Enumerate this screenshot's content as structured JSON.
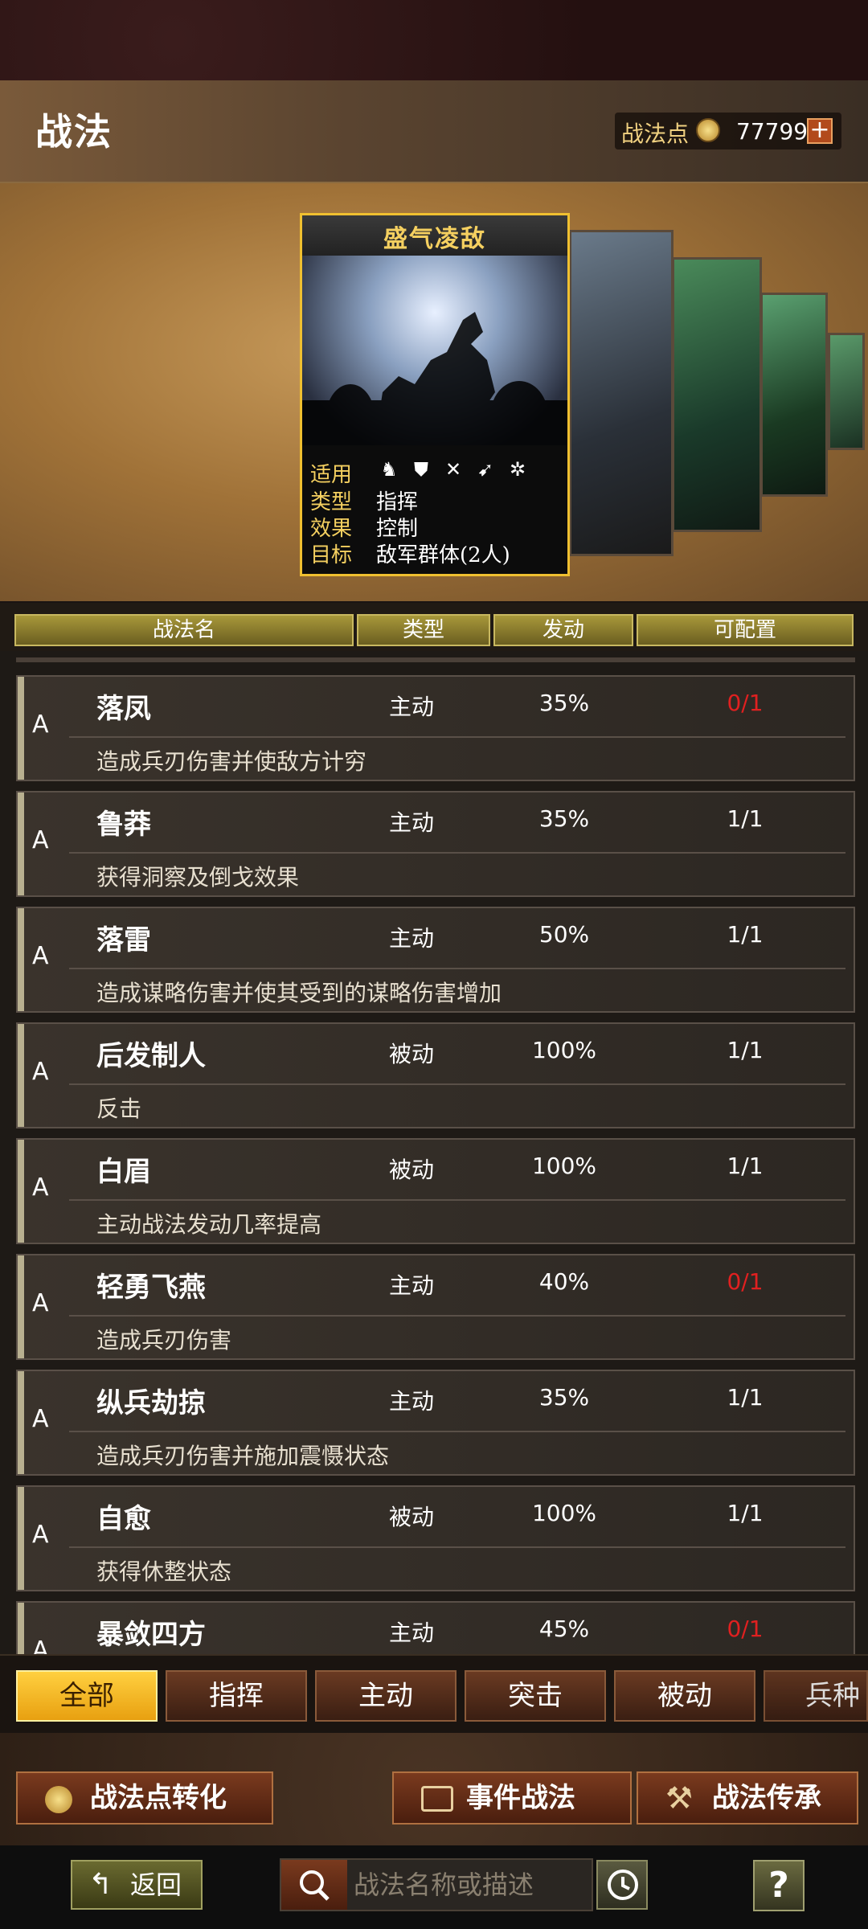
{
  "header": {
    "title": "战法",
    "points_label": "战法点",
    "points_value": "77799",
    "plus": "+"
  },
  "card": {
    "title": "盛气凌敌",
    "rows": [
      {
        "key": "适用",
        "value": ""
      },
      {
        "key": "类型",
        "value": "指挥"
      },
      {
        "key": "效果",
        "value": "控制"
      },
      {
        "key": "目标",
        "value": "敌军群体(2人)"
      }
    ]
  },
  "table": {
    "headers": [
      "战法名",
      "类型",
      "发动",
      "可配置"
    ],
    "rows": [
      {
        "grade": "A",
        "name": "落凤",
        "type": "主动",
        "rate": "35%",
        "avail": "0/1",
        "desc": "造成兵刃伤害并使敌方计穷",
        "red": true
      },
      {
        "grade": "A",
        "name": "鲁莽",
        "type": "主动",
        "rate": "35%",
        "avail": "1/1",
        "desc": "获得洞察及倒戈效果",
        "red": false
      },
      {
        "grade": "A",
        "name": "落雷",
        "type": "主动",
        "rate": "50%",
        "avail": "1/1",
        "desc": "造成谋略伤害并使其受到的谋略伤害增加",
        "red": false
      },
      {
        "grade": "A",
        "name": "后发制人",
        "type": "被动",
        "rate": "100%",
        "avail": "1/1",
        "desc": "反击",
        "red": false
      },
      {
        "grade": "A",
        "name": "白眉",
        "type": "被动",
        "rate": "100%",
        "avail": "1/1",
        "desc": "主动战法发动几率提高",
        "red": false
      },
      {
        "grade": "A",
        "name": "轻勇飞燕",
        "type": "主动",
        "rate": "40%",
        "avail": "0/1",
        "desc": "造成兵刃伤害",
        "red": true
      },
      {
        "grade": "A",
        "name": "纵兵劫掠",
        "type": "主动",
        "rate": "35%",
        "avail": "1/1",
        "desc": "造成兵刃伤害并施加震慑状态",
        "red": false
      },
      {
        "grade": "A",
        "name": "自愈",
        "type": "被动",
        "rate": "100%",
        "avail": "1/1",
        "desc": "获得休整状态",
        "red": false
      },
      {
        "grade": "A",
        "name": "暴敛四方",
        "type": "主动",
        "rate": "45%",
        "avail": "0/1",
        "desc": "",
        "red": true
      }
    ]
  },
  "tabs": [
    "全部",
    "指挥",
    "主动",
    "突击",
    "被动",
    "兵种"
  ],
  "actions": {
    "convert": "战法点转化",
    "event": "事件战法",
    "inherit": "战法传承"
  },
  "footer": {
    "back": "返回",
    "search_placeholder": "战法名称或描述",
    "help": "?"
  },
  "colors": {
    "accent": "#f5d060",
    "red": "#e02020",
    "active_tab": "#ffd040"
  }
}
